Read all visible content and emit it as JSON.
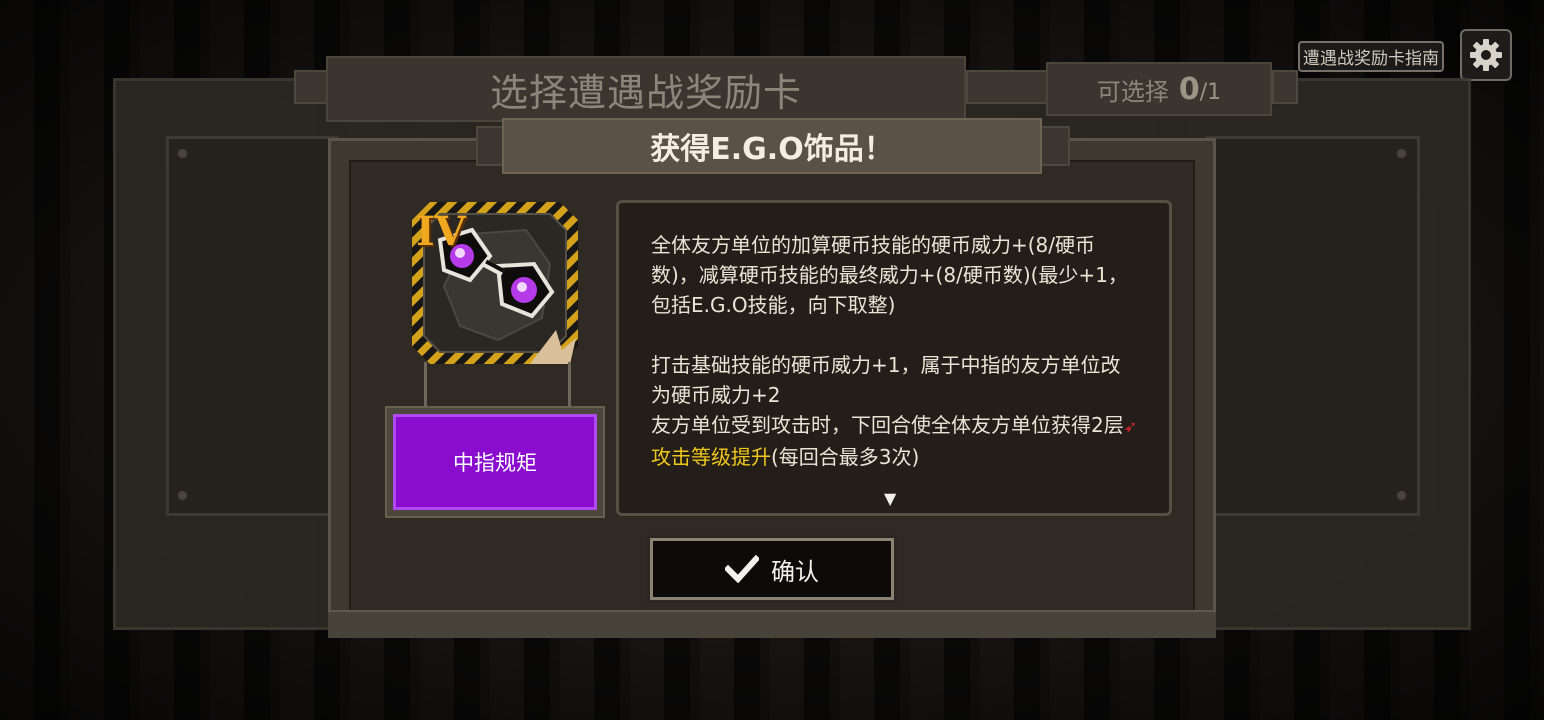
{
  "background_title": "选择遭遇战奖励卡",
  "selection": {
    "label": "可选择",
    "current": "0",
    "max": "/1"
  },
  "top_right": {
    "guide_label": "遭遇战奖励卡指南",
    "settings_icon": "gear-icon"
  },
  "popup": {
    "title": "获得E.G.O饰品！",
    "item": {
      "tier": "IV",
      "name": "中指规矩",
      "name_color": "#8a0ccf",
      "icon": "sunglasses-icon"
    },
    "description": {
      "paragraph1": "全体友方单位的加算硬币技能的硬币威力+(8/硬币数)，减算硬币技能的最终威力+(8/硬币数)(最少+1，包括E.G.O技能，向下取整)",
      "paragraph2": "打击基础技能的硬币威力+1，属于中指的友方单位改为硬币威力+2",
      "paragraph3_start": "友方单位受到攻击时，下回合使全体友方单位获得2层",
      "keyword": "攻击等级提升",
      "keyword_color": "#f0c81c",
      "paragraph3_end": "(每回合最多3次)"
    },
    "confirm_label": "确认"
  }
}
